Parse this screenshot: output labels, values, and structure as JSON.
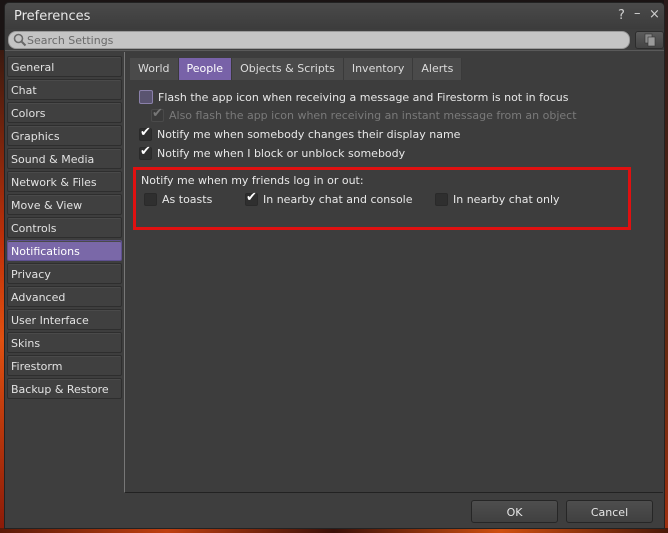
{
  "window": {
    "title": "Preferences",
    "help_label": "?",
    "minimize_label": "–",
    "close_label": "×"
  },
  "search": {
    "placeholder": "Search Settings",
    "value": ""
  },
  "sidebar": {
    "items": [
      {
        "label": "General"
      },
      {
        "label": "Chat"
      },
      {
        "label": "Colors"
      },
      {
        "label": "Graphics"
      },
      {
        "label": "Sound & Media"
      },
      {
        "label": "Network & Files"
      },
      {
        "label": "Move & View"
      },
      {
        "label": "Controls"
      },
      {
        "label": "Notifications",
        "active": true
      },
      {
        "label": "Privacy"
      },
      {
        "label": "Advanced"
      },
      {
        "label": "User Interface"
      },
      {
        "label": "Skins"
      },
      {
        "label": "Firestorm"
      },
      {
        "label": "Backup & Restore"
      }
    ]
  },
  "tabs": [
    {
      "label": "World"
    },
    {
      "label": "People",
      "active": true
    },
    {
      "label": "Objects & Scripts"
    },
    {
      "label": "Inventory"
    },
    {
      "label": "Alerts"
    }
  ],
  "options": [
    {
      "label": "Flash the app icon when receiving a message and Firestorm is not in focus",
      "checked": false
    },
    {
      "label": "Also flash the app icon when receiving an instant message from an object",
      "checked": true,
      "disabled": true
    },
    {
      "label": "Notify me when somebody changes their display name",
      "checked": true
    },
    {
      "label": "Notify me when I block or unblock somebody",
      "checked": true
    }
  ],
  "friends_group": {
    "label": "Notify me when my friends log in or out:",
    "options": [
      {
        "label": "As toasts",
        "checked": false
      },
      {
        "label": "In nearby chat and console",
        "checked": true
      },
      {
        "label": "In nearby chat only",
        "checked": false
      }
    ]
  },
  "buttons": {
    "ok": "OK",
    "cancel": "Cancel"
  },
  "colors": {
    "accent": "#7862a8",
    "highlight_box": "#e01010"
  }
}
